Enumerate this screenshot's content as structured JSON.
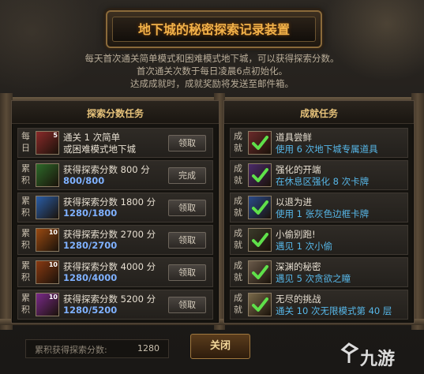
{
  "title": "地下城的秘密探索记录装置",
  "description": [
    "每天首次通关简单模式和困难模式地下城，可以获得探索分数。",
    "首次通关次数于每日凌晨6点初始化。",
    "达成成就时，成就奖励将发送至邮件箱。"
  ],
  "left_panel": {
    "title": "探索分数任务",
    "rows": [
      {
        "tag": "每日",
        "level": "5",
        "line1": "通关 1 次简单",
        "line2": "或困难模式地下城",
        "progress": "",
        "button": "领取",
        "icon_color": "#8a2a2a"
      },
      {
        "tag": "累积",
        "level": "",
        "line1": "获得探索分数 800 分",
        "line2": "",
        "progress": "800/800",
        "button": "完成",
        "icon_color": "#2d6a2a"
      },
      {
        "tag": "累积",
        "level": "",
        "line1": "获得探索分数 1800 分",
        "line2": "",
        "progress": "1280/1800",
        "button": "领取",
        "icon_color": "#2a5ea8"
      },
      {
        "tag": "累积",
        "level": "10",
        "line1": "获得探索分数 2700 分",
        "line2": "",
        "progress": "1280/2700",
        "button": "领取",
        "icon_color": "#9a4a12"
      },
      {
        "tag": "累积",
        "level": "10",
        "line1": "获得探索分数 4000 分",
        "line2": "",
        "progress": "1280/4000",
        "button": "领取",
        "icon_color": "#8a3a12"
      },
      {
        "tag": "累积",
        "level": "10",
        "line1": "获得探索分数 5200 分",
        "line2": "",
        "progress": "1280/5200",
        "button": "领取",
        "icon_color": "#7a2a8a"
      }
    ]
  },
  "right_panel": {
    "title": "成就任务",
    "rows": [
      {
        "tag": "成就",
        "line1": "道具尝鲜",
        "line2": "使用 6 次地下城专属道具",
        "icon_color": "#6a2a2a"
      },
      {
        "tag": "成就",
        "line1": "强化的开端",
        "line2": "在休息区强化 8 次卡牌",
        "icon_color": "#4a2a6a"
      },
      {
        "tag": "成就",
        "line1": "以退为进",
        "line2": "使用 1 张灰色边框卡牌",
        "icon_color": "#2a4a8a"
      },
      {
        "tag": "成就",
        "line1": "小偷别跑!",
        "line2": "遇见 1 次小偷",
        "icon_color": "#3a3a2a"
      },
      {
        "tag": "成就",
        "line1": "深渊的秘密",
        "line2": "遇见 5 次贪欲之瞳",
        "icon_color": "#6a5a4a"
      },
      {
        "tag": "成就",
        "line1": "无尽的挑战",
        "line2": "通关 10 次无限模式第 40 层",
        "icon_color": "#7a6a4a"
      }
    ]
  },
  "footer": {
    "score_label": "累积获得探索分数:",
    "score_value": "1280",
    "close_label": "关闭"
  },
  "watermark": "九游"
}
